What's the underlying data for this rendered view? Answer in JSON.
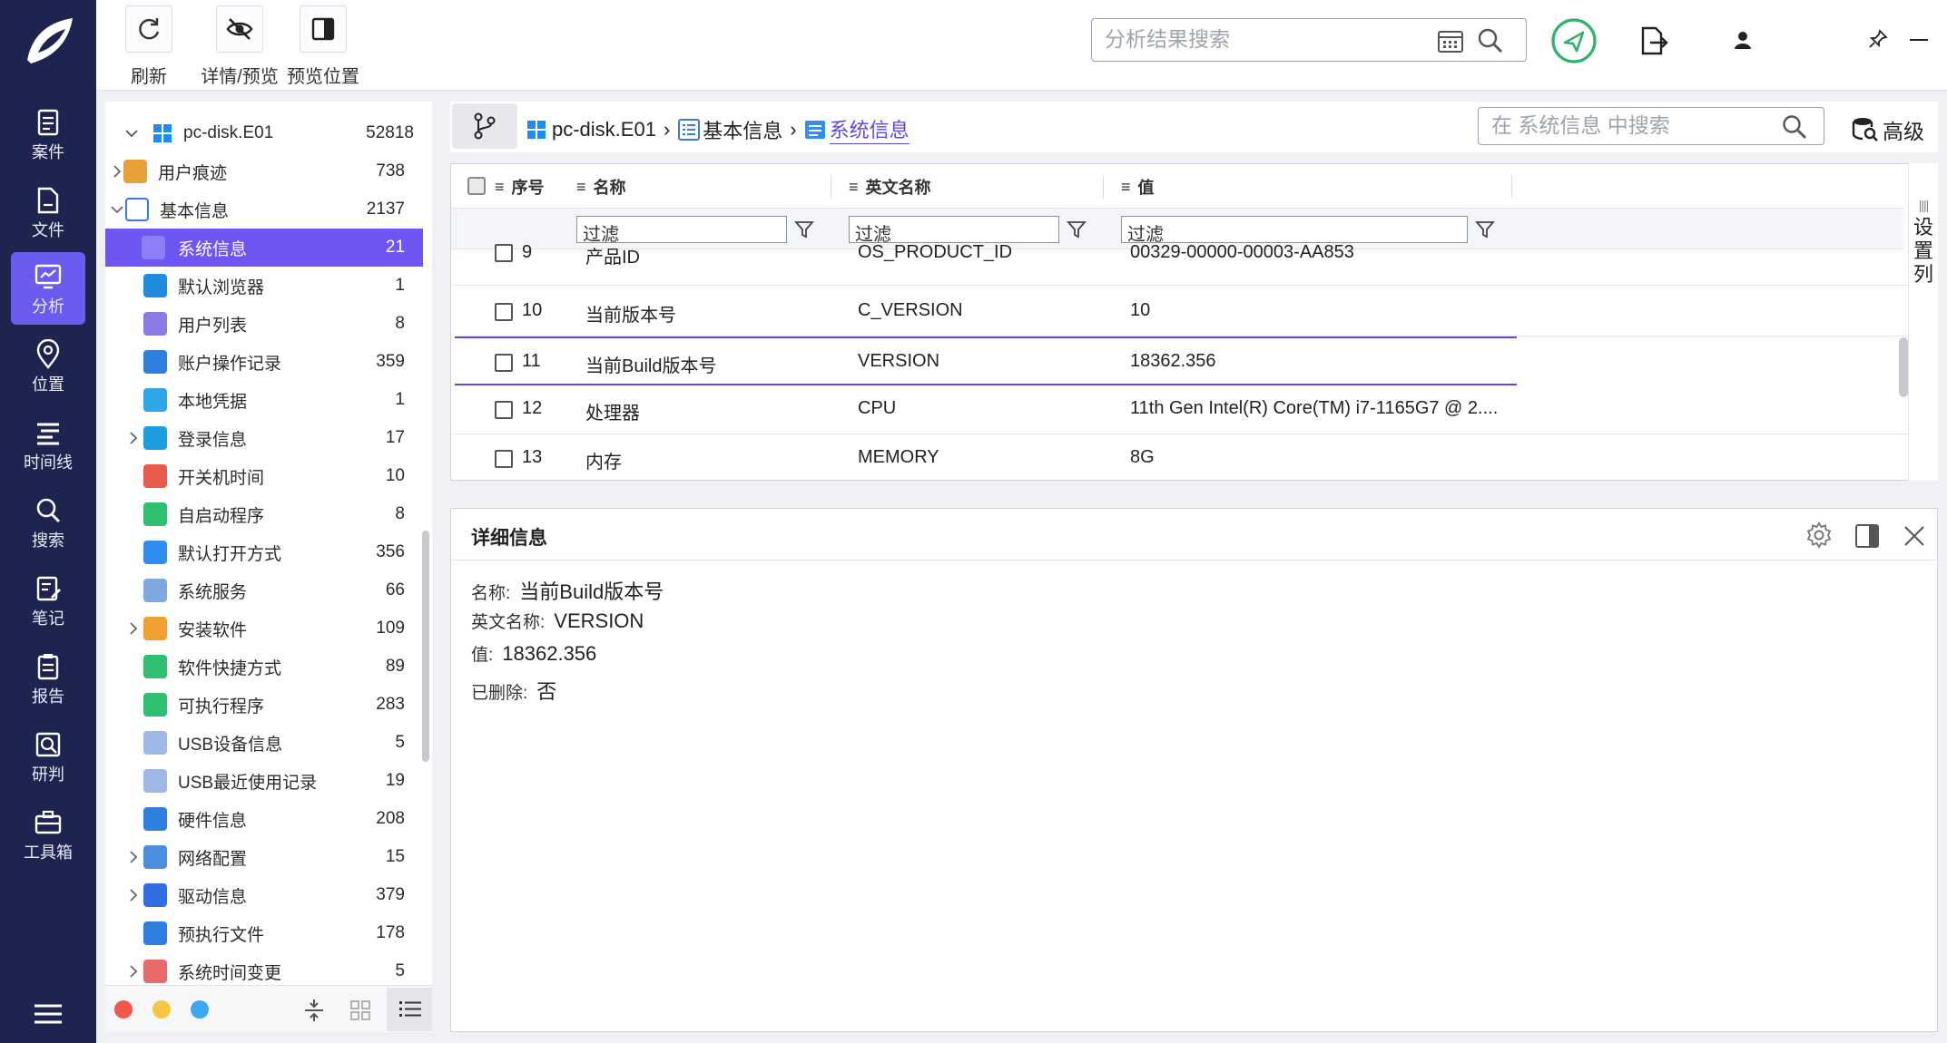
{
  "nav": {
    "items": [
      {
        "label": "案件",
        "icon": "case-icon"
      },
      {
        "label": "文件",
        "icon": "file-icon"
      },
      {
        "label": "分析",
        "icon": "analysis-icon"
      },
      {
        "label": "位置",
        "icon": "location-icon"
      },
      {
        "label": "时间线",
        "icon": "timeline-icon"
      },
      {
        "label": "搜索",
        "icon": "search-icon"
      },
      {
        "label": "笔记",
        "icon": "note-icon"
      },
      {
        "label": "报告",
        "icon": "report-icon"
      },
      {
        "label": "研判",
        "icon": "judge-icon"
      },
      {
        "label": "工具箱",
        "icon": "toolbox-icon"
      }
    ],
    "active_color": "#6b5cf0",
    "bg_color": "#1e2450"
  },
  "toolbar": {
    "refresh_label": "刷新",
    "detail_preview_label": "详情/预览",
    "preview_position_label": "预览位置",
    "search_placeholder": "分析结果搜索"
  },
  "tree": {
    "root": {
      "label": "pc-disk.E01",
      "count": "52818"
    },
    "items": [
      {
        "label": "用户痕迹",
        "count": "738",
        "color": "#e8a13a"
      },
      {
        "label": "基本信息",
        "count": "2137",
        "color": "#3a7bd5"
      },
      {
        "label": "系统信息",
        "count": "21",
        "color": "#2f8ef0"
      },
      {
        "label": "默认浏览器",
        "count": "1",
        "color": "#1f8ce0"
      },
      {
        "label": "用户列表",
        "count": "8",
        "color": "#8a7be8"
      },
      {
        "label": "账户操作记录",
        "count": "359",
        "color": "#2f7fe0"
      },
      {
        "label": "本地凭据",
        "count": "1",
        "color": "#2fa6e8"
      },
      {
        "label": "登录信息",
        "count": "17",
        "color": "#1e9ee0"
      },
      {
        "label": "开关机时间",
        "count": "10",
        "color": "#e85a4a"
      },
      {
        "label": "自启动程序",
        "count": "8",
        "color": "#2fbf71"
      },
      {
        "label": "默认打开方式",
        "count": "356",
        "color": "#2f8ef0"
      },
      {
        "label": "系统服务",
        "count": "66",
        "color": "#7fa8e0"
      },
      {
        "label": "安装软件",
        "count": "109",
        "color": "#f0a030"
      },
      {
        "label": "软件快捷方式",
        "count": "89",
        "color": "#2fbf71"
      },
      {
        "label": "可执行程序",
        "count": "283",
        "color": "#2fbf71"
      },
      {
        "label": "USB设备信息",
        "count": "5",
        "color": "#9fb8e8"
      },
      {
        "label": "USB最近使用记录",
        "count": "19",
        "color": "#9fb8e8"
      },
      {
        "label": "硬件信息",
        "count": "208",
        "color": "#2f7fe0"
      },
      {
        "label": "网络配置",
        "count": "15",
        "color": "#4a8ee0"
      },
      {
        "label": "驱动信息",
        "count": "379",
        "color": "#2f6fe0"
      },
      {
        "label": "预执行文件",
        "count": "178",
        "color": "#2f7fe0"
      },
      {
        "label": "系统时间变更",
        "count": "5",
        "color": "#e86a6a"
      }
    ],
    "selected_color": "#6e56f2"
  },
  "breadcrumb": {
    "items": [
      "pc-disk.E01",
      "基本信息",
      "系统信息"
    ],
    "search_placeholder": "在 系统信息 中搜索",
    "advanced_label": "高级"
  },
  "table": {
    "columns": [
      "序号",
      "名称",
      "英文名称",
      "值"
    ],
    "filter_placeholder": "过滤",
    "rows": [
      {
        "no": "9",
        "name": "产品ID",
        "en": "OS_PRODUCT_ID",
        "value": "00329-00000-00003-AA853"
      },
      {
        "no": "10",
        "name": "当前版本号",
        "en": "C_VERSION",
        "value": "10"
      },
      {
        "no": "11",
        "name": "当前Build版本号",
        "en": "VERSION",
        "value": "18362.356"
      },
      {
        "no": "12",
        "name": "处理器",
        "en": "CPU",
        "value": "11th Gen Intel(R) Core(TM) i7-1165G7 @ 2...."
      },
      {
        "no": "13",
        "name": "内存",
        "en": "MEMORY",
        "value": "8G"
      }
    ],
    "settings_column_label": "设置列"
  },
  "detail": {
    "title": "详细信息",
    "fields": [
      {
        "key": "名称:",
        "value": "当前Build版本号"
      },
      {
        "key": "英文名称:",
        "value": "VERSION"
      },
      {
        "key": "值:",
        "value": "18362.356"
      },
      {
        "key": "已删除:",
        "value": "否"
      }
    ]
  }
}
